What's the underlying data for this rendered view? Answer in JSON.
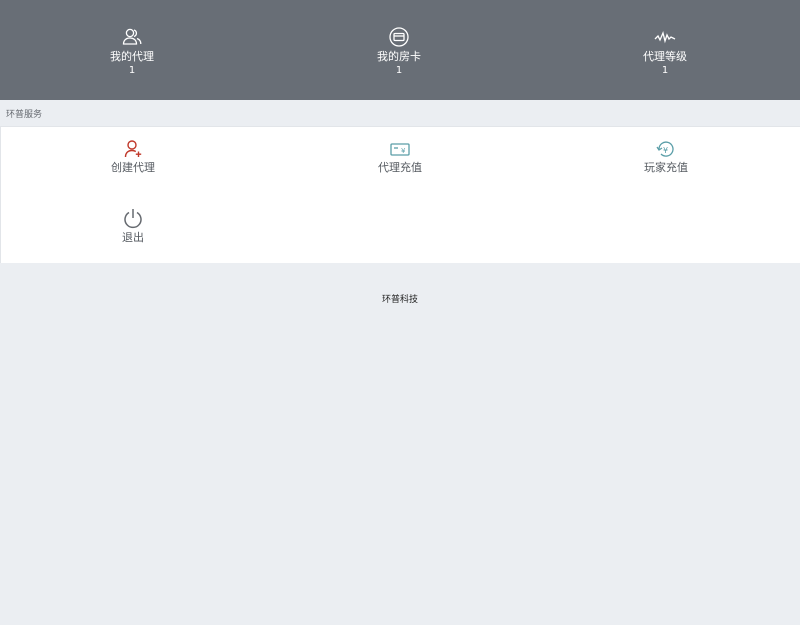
{
  "header": {
    "stats": [
      {
        "label": "我的代理",
        "value": "1",
        "icon": "users-icon"
      },
      {
        "label": "我的房卡",
        "value": "1",
        "icon": "card-icon"
      },
      {
        "label": "代理等级",
        "value": "1",
        "icon": "wave-icon"
      }
    ]
  },
  "services": {
    "title": "环普服务",
    "items": [
      {
        "label": "创建代理",
        "icon": "add-user-icon",
        "color": "#c0392b"
      },
      {
        "label": "代理充值",
        "icon": "recharge-card-icon",
        "color": "#5a9ea8"
      },
      {
        "label": "玩家充值",
        "icon": "yen-refresh-icon",
        "color": "#5a9ea8"
      },
      {
        "label": "退出",
        "icon": "power-icon",
        "color": "#666a70"
      }
    ]
  },
  "footer": {
    "text": "环普科技"
  }
}
